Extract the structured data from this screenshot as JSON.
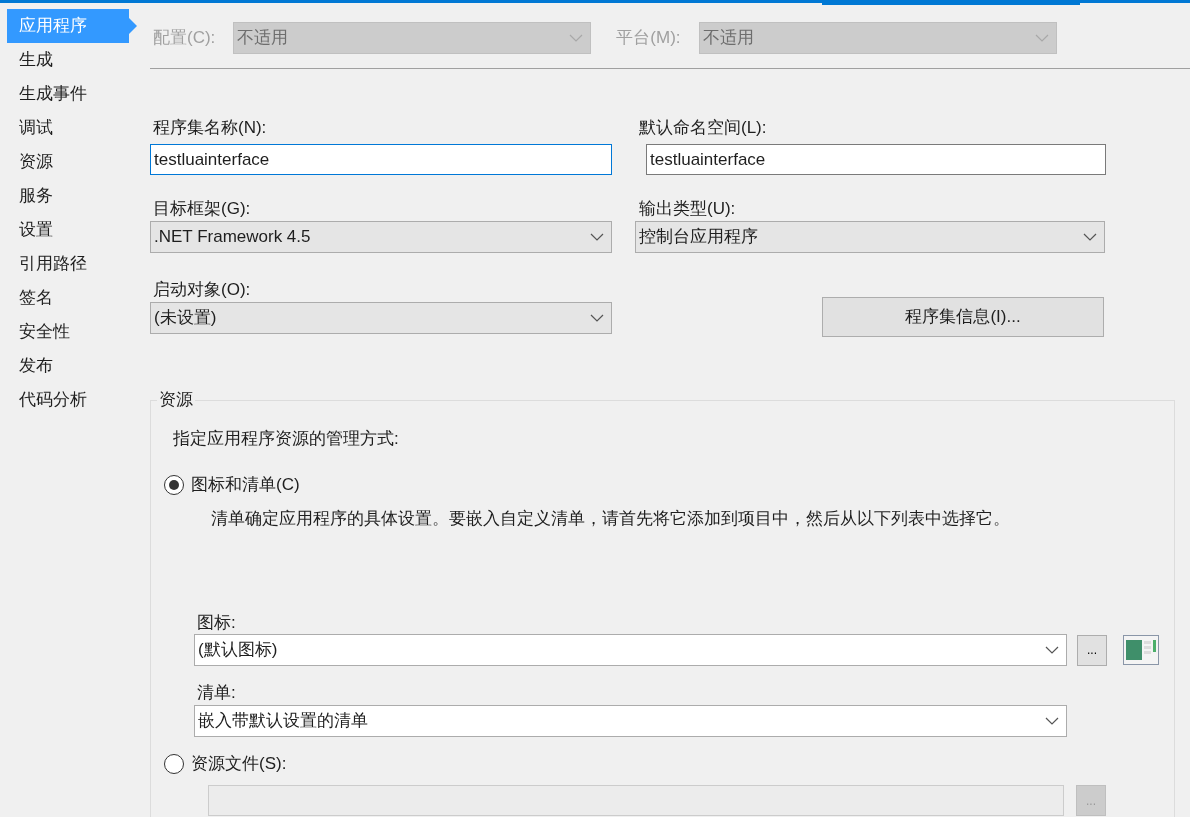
{
  "sidebar": {
    "items": [
      {
        "label": "应用程序",
        "selected": true
      },
      {
        "label": "生成",
        "selected": false
      },
      {
        "label": "生成事件",
        "selected": false
      },
      {
        "label": "调试",
        "selected": false
      },
      {
        "label": "资源",
        "selected": false
      },
      {
        "label": "服务",
        "selected": false
      },
      {
        "label": "设置",
        "selected": false
      },
      {
        "label": "引用路径",
        "selected": false
      },
      {
        "label": "签名",
        "selected": false
      },
      {
        "label": "安全性",
        "selected": false
      },
      {
        "label": "发布",
        "selected": false
      },
      {
        "label": "代码分析",
        "selected": false
      }
    ]
  },
  "toolbar": [
    {
      "label": "配置(C):",
      "value": "不适用",
      "disabled": true
    },
    {
      "label": "平台(M):",
      "value": "不适用",
      "disabled": true
    }
  ],
  "fields": [
    {
      "kind": "text",
      "label": "程序集名称(N):",
      "value": "testluainterface",
      "focused": true
    },
    {
      "kind": "text",
      "label": "默认命名空间(L):",
      "value": "testluainterface",
      "focused": false
    },
    {
      "kind": "combo",
      "label": "目标框架(G):",
      "value": ".NET Framework 4.5"
    },
    {
      "kind": "combo",
      "label": "输出类型(U):",
      "value": "控制台应用程序"
    },
    {
      "kind": "combo",
      "label": "启动对象(O):",
      "value": "(未设置)"
    },
    {
      "kind": "button",
      "label": "程序集信息(I)..."
    }
  ],
  "resources": {
    "title": "资源",
    "prompt": "指定应用程序资源的管理方式:",
    "options": [
      {
        "label": "图标和清单(C)",
        "selected": true
      },
      {
        "label": "资源文件(S):",
        "selected": false
      }
    ],
    "description": "清单确定应用程序的具体设置。要嵌入自定义清单，请首先将它添加到项目中，然后从以下列表中选择它。",
    "icon": {
      "label": "图标:",
      "value": "(默认图标)",
      "browse": "...",
      "browse_disabled": false
    },
    "manifest": {
      "label": "清单:",
      "value": "嵌入带默认设置的清单"
    },
    "resource_file": {
      "value_disabled": true,
      "browse": "...",
      "browse_disabled": true
    }
  }
}
